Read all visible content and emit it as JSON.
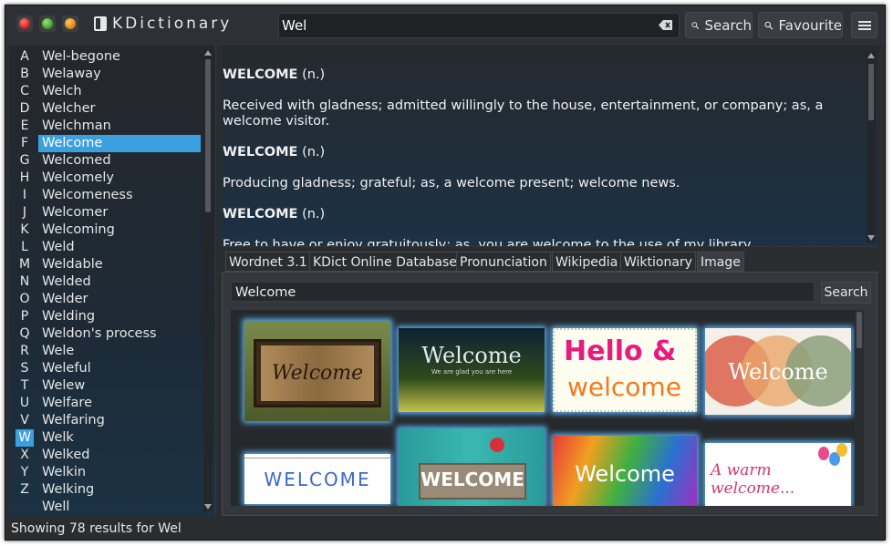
{
  "app": {
    "title": "KDictionary",
    "logo_icon": "book-icon"
  },
  "window_controls": [
    "close-icon",
    "maximize-icon",
    "minimize-icon"
  ],
  "search": {
    "value": "Wel",
    "placeholder": ""
  },
  "toolbar": {
    "search_label": "Search",
    "favourite_label": "Favourite",
    "menu_icon": "hamburger-icon"
  },
  "alphabet": [
    "A",
    "B",
    "C",
    "D",
    "E",
    "F",
    "G",
    "H",
    "I",
    "J",
    "K",
    "L",
    "M",
    "N",
    "O",
    "P",
    "Q",
    "R",
    "S",
    "T",
    "U",
    "V",
    "W",
    "X",
    "Y",
    "Z"
  ],
  "alphabet_selected": "W",
  "words": [
    "Wel-begone",
    "Welaway",
    "Welch",
    "Welcher",
    "Welchman",
    "Welcome",
    "Welcomed",
    "Welcomely",
    "Welcomeness",
    "Welcomer",
    "Welcoming",
    "Weld",
    "Weldable",
    "Welded",
    "Welder",
    "Welding",
    "Weldon's process",
    "Wele",
    "Weleful",
    "Welew",
    "Welfare",
    "Welfaring",
    "Welk",
    "Welked",
    "Welkin",
    "Welking",
    "Well"
  ],
  "selected_word": "Welcome",
  "definitions": [
    {
      "term": "WELCOME",
      "pos": "(n.)",
      "text": "Received with gladness; admitted willingly to the house, entertainment, or company; as, a welcome visitor."
    },
    {
      "term": "WELCOME",
      "pos": "(n.)",
      "text": "Producing gladness; grateful; as, a welcome present; welcome news."
    },
    {
      "term": "WELCOME",
      "pos": "(n.)",
      "text": "Free to have or enjoy gratuitously; as, you are welcome to the use of my library."
    }
  ],
  "tabs": [
    "Wordnet 3.1",
    "KDict Online Database",
    "Pronunciation",
    "Wikipedia",
    "Wiktionary",
    "Image"
  ],
  "active_tab": "Image",
  "image_search": {
    "value": "Welcome",
    "button_label": "Search"
  },
  "images": [
    {
      "caption": "Welcome",
      "style": "wood-sign"
    },
    {
      "caption": "Welcome",
      "subcaption": "We are glad you are here",
      "style": "field"
    },
    {
      "caption": "Hello &",
      "caption2": "welcome",
      "style": "hello"
    },
    {
      "caption": "Welcome",
      "style": "circles"
    },
    {
      "caption": "WELCOME",
      "style": "pegs"
    },
    {
      "caption": "WELCOME",
      "style": "teal-sign"
    },
    {
      "caption": "Welcome",
      "style": "paint"
    },
    {
      "caption": "A warm welcome...",
      "style": "balloons"
    }
  ],
  "status": {
    "text": "Showing 78 results for Wel"
  }
}
